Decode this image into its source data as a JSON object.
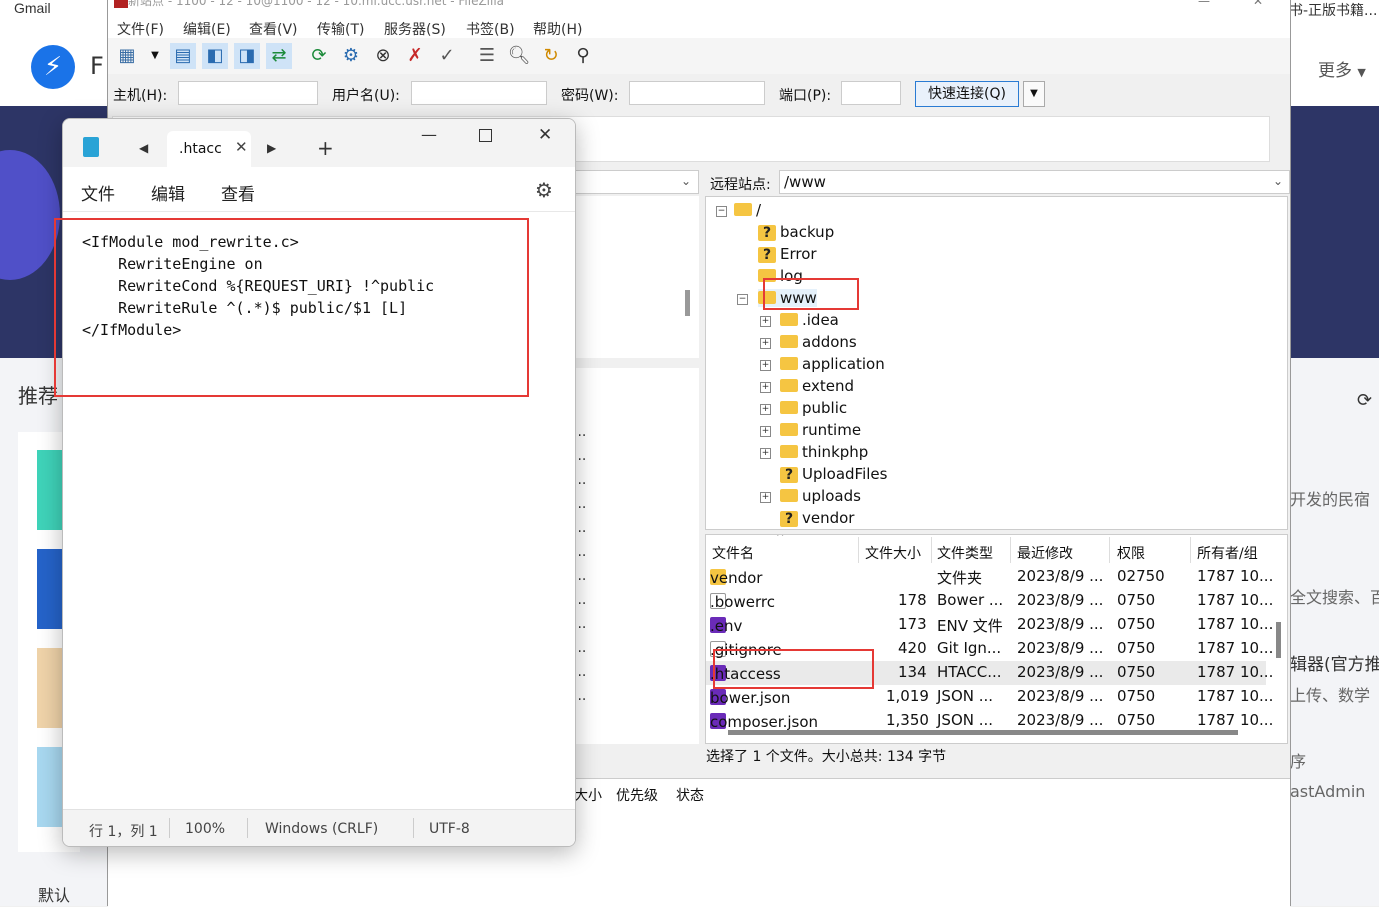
{
  "browser": {
    "gmail_label": "Gmail",
    "logo_letter": "F",
    "more_label": "更多",
    "right_tab_title": "书-正版书籍...",
    "recommend_heading": "推荐",
    "default_tab": "默认",
    "right_snippets": [
      "开发的民宿",
      "全文搜索、百",
      "辑器(官方推",
      "上传、数学",
      "序",
      "astAdmin"
    ]
  },
  "filezilla": {
    "title": "新站点 - 1100 - 12 - 10@1100 - 12 - 10.ml.ucc.usr.net - FileZilla",
    "menus": [
      "文件(F)",
      "编辑(E)",
      "查看(V)",
      "传输(T)",
      "服务器(S)",
      "书签(B)",
      "帮助(H)"
    ],
    "quickconnect": {
      "host_label": "主机(H):",
      "user_label": "用户名(U):",
      "pass_label": "密码(W):",
      "port_label": "端口(P):",
      "button_label": "快速连接(Q)"
    },
    "remote": {
      "site_label": "远程站点:",
      "path": "/www",
      "tree": {
        "root": "/",
        "root_children": [
          {
            "name": "backup",
            "icon": "unknown-folder-icon"
          },
          {
            "name": "Error",
            "icon": "unknown-folder-icon"
          },
          {
            "name": "log",
            "icon": "folder-icon"
          },
          {
            "name": "www",
            "icon": "folder-icon"
          }
        ],
        "www_children": [
          {
            "name": ".idea",
            "icon": "folder-icon"
          },
          {
            "name": "addons",
            "icon": "folder-icon"
          },
          {
            "name": "application",
            "icon": "folder-icon"
          },
          {
            "name": "extend",
            "icon": "folder-icon"
          },
          {
            "name": "public",
            "icon": "folder-icon"
          },
          {
            "name": "runtime",
            "icon": "folder-icon"
          },
          {
            "name": "thinkphp",
            "icon": "folder-icon"
          },
          {
            "name": "UploadFiles",
            "icon": "unknown-folder-icon"
          },
          {
            "name": "uploads",
            "icon": "folder-icon"
          },
          {
            "name": "vendor",
            "icon": "unknown-folder-icon"
          }
        ]
      },
      "columns": [
        "文件名",
        "文件大小",
        "文件类型",
        "最近修改",
        "权限",
        "所有者/组"
      ],
      "files": [
        {
          "name": "vendor",
          "size": "",
          "type": "文件夹",
          "modified": "2023/8/9 ...",
          "perm": "02750",
          "owner": "1787 10...",
          "icon": "folder-icon"
        },
        {
          "name": ".bowerrc",
          "size": "178",
          "type": "Bower ...",
          "modified": "2023/8/9 ...",
          "perm": "0750",
          "owner": "1787 10...",
          "icon": "file-icon"
        },
        {
          "name": ".env",
          "size": "173",
          "type": "ENV 文件",
          "modified": "2023/8/9 ...",
          "perm": "0750",
          "owner": "1787 10...",
          "icon": "phpstorm-icon"
        },
        {
          "name": ".gitignore",
          "size": "420",
          "type": "Git Ign...",
          "modified": "2023/8/9 ...",
          "perm": "0750",
          "owner": "1787 10...",
          "icon": "file-icon"
        },
        {
          "name": ".htaccess",
          "size": "134",
          "type": "HTACC...",
          "modified": "2023/8/9 ...",
          "perm": "0750",
          "owner": "1787 10...",
          "icon": "phpstorm-icon"
        },
        {
          "name": "bower.json",
          "size": "1,019",
          "type": "JSON ...",
          "modified": "2023/8/9 ...",
          "perm": "0750",
          "owner": "1787 10...",
          "icon": "phpstorm-icon"
        },
        {
          "name": "composer.json",
          "size": "1,350",
          "type": "JSON ...",
          "modified": "2023/8/9 ...",
          "perm": "0750",
          "owner": "1787 10...",
          "icon": "phpstorm-icon"
        }
      ],
      "status": "选择了 1 个文件。大小总共: 134 字节"
    },
    "queue_headers": [
      "大小",
      "优先级",
      "状态"
    ],
    "local_ellipsis": "..."
  },
  "notepad": {
    "tab_title": ".htacc",
    "tab_close": "✕",
    "menus": [
      "文件",
      "编辑",
      "查看"
    ],
    "code": "<IfModule mod_rewrite.c>\n    RewriteEngine on\n    RewriteCond %{REQUEST_URI} !^public\n    RewriteRule ^(.*)$ public/$1 [L]\n</IfModule>",
    "status": {
      "position": "行 1，列 1",
      "zoom": "100%",
      "line_ending": "Windows (CRLF)",
      "encoding": "UTF-8"
    }
  },
  "colors": {
    "highlight_red": "#e53935",
    "folder_yellow": "#f5c542",
    "hero_bg": "#2d3566",
    "accent_blue": "#1a73e8"
  }
}
